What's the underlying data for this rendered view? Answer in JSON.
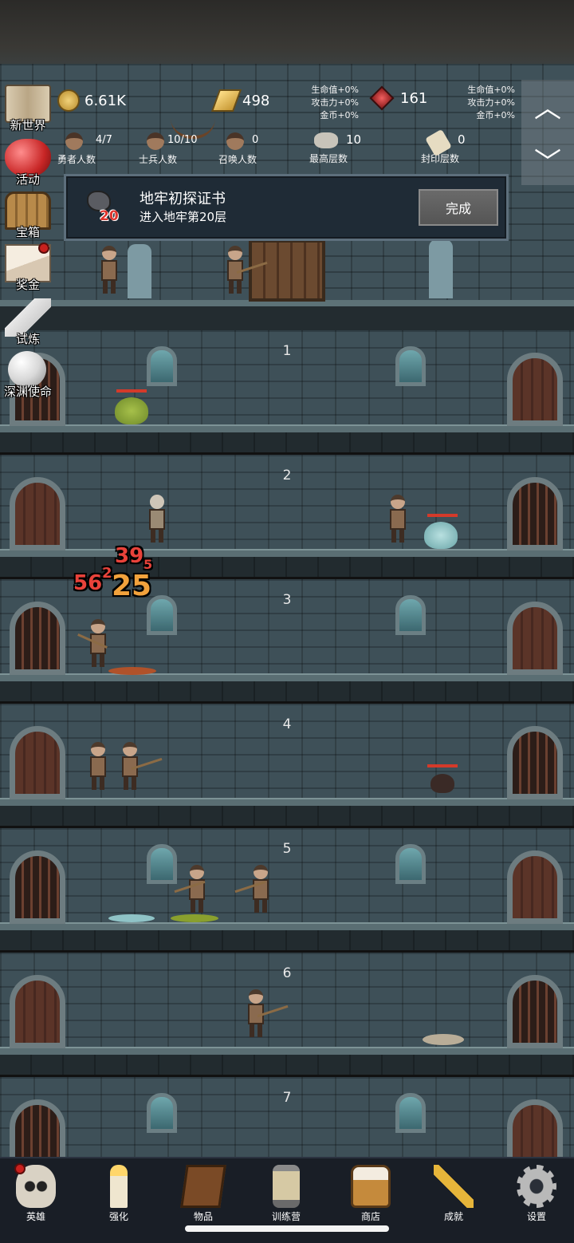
{
  "resources": {
    "coins": "6.61K",
    "gold": "498",
    "gems": "161",
    "gold_bonus": [
      "生命值+0%",
      "攻击力+0%",
      "金币+0%"
    ],
    "gem_bonus": [
      "生命值+0%",
      "攻击力+0%",
      "金币+0%"
    ]
  },
  "counts": [
    {
      "value": "4/7",
      "label": "勇者人数"
    },
    {
      "value": "10/10",
      "label": "士兵人数"
    },
    {
      "value": "0",
      "label": "召唤人数"
    },
    {
      "value": "10",
      "label": "最高层数"
    },
    {
      "value": "0",
      "label": "封印层数"
    }
  ],
  "arrows": {
    "up_icon": "chevron-up-icon",
    "down_icon": "chevron-down-icon",
    "up": "︿",
    "down": "﹀"
  },
  "quest": {
    "title": "地牢初探证书",
    "description": "进入地牢第20层",
    "icon_number": "20",
    "button": "完成"
  },
  "side_menu": [
    {
      "label": "新世界",
      "icon": "map-scroll-icon",
      "badge": false
    },
    {
      "label": "活动",
      "icon": "heart-icon",
      "badge": false
    },
    {
      "label": "宝箱",
      "icon": "treasure-chest-icon",
      "badge": false
    },
    {
      "label": "奖金",
      "icon": "envelope-icon",
      "badge": true
    },
    {
      "label": "试炼",
      "icon": "feather-icon",
      "badge": false
    },
    {
      "label": "深渊使命",
      "icon": "pearl-icon",
      "badge": false
    }
  ],
  "floors": [
    "1",
    "2",
    "3",
    "4",
    "5",
    "6",
    "7"
  ],
  "damage_numbers": [
    "39",
    "5",
    "56",
    "2",
    "25"
  ],
  "bottom_nav": [
    {
      "label": "英雄",
      "icon": "skull-icon",
      "badge": true
    },
    {
      "label": "强化",
      "icon": "candle-icon",
      "badge": false
    },
    {
      "label": "物品",
      "icon": "book-icon",
      "badge": false
    },
    {
      "label": "训练营",
      "icon": "lantern-icon",
      "badge": false
    },
    {
      "label": "商店",
      "icon": "beer-mug-icon",
      "badge": false
    },
    {
      "label": "成就",
      "icon": "key-icon",
      "badge": false
    },
    {
      "label": "设置",
      "icon": "gear-icon",
      "badge": false
    }
  ],
  "colors": {
    "accent_red": "#d43a2a",
    "wall": "#3e5058",
    "nav_bg": "#191e26"
  }
}
